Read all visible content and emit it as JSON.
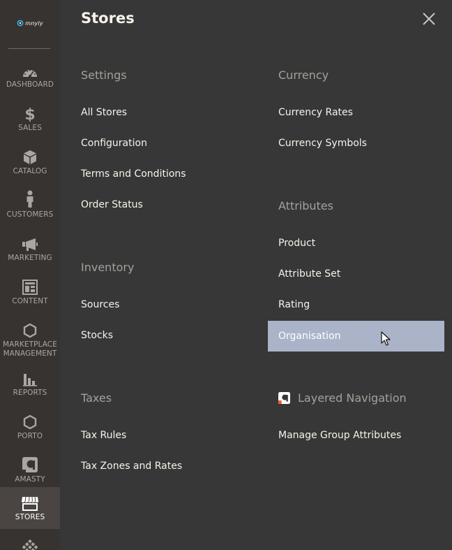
{
  "sidebar": {
    "logo_text": "mnyly",
    "items": [
      {
        "key": "dashboard",
        "label": "DASHBOARD",
        "icon": "dashboard-icon"
      },
      {
        "key": "sales",
        "label": "SALES",
        "icon": "dollar-icon"
      },
      {
        "key": "catalog",
        "label": "CATALOG",
        "icon": "box-icon"
      },
      {
        "key": "customers",
        "label": "CUSTOMERS",
        "icon": "person-icon"
      },
      {
        "key": "marketing",
        "label": "MARKETING",
        "icon": "megaphone-icon"
      },
      {
        "key": "content",
        "label": "CONTENT",
        "icon": "layout-icon"
      },
      {
        "key": "marketplace",
        "label": "MARKETPLACE\nMANAGEMENT",
        "label_line1": "MARKETPLACE",
        "label_line2": "MANAGEMENT",
        "icon": "hexagon-icon"
      },
      {
        "key": "reports",
        "label": "REPORTS",
        "icon": "bar-chart-icon"
      },
      {
        "key": "porto",
        "label": "PORTO",
        "icon": "hexagon-icon"
      },
      {
        "key": "amasty",
        "label": "AMASTY",
        "icon": "amasty-icon"
      },
      {
        "key": "stores",
        "label": "STORES",
        "icon": "storefront-icon",
        "active": true
      },
      {
        "key": "system",
        "label": "",
        "icon": "grid-diamond-icon"
      }
    ]
  },
  "panel": {
    "title": "Stores",
    "close_icon": "close-icon",
    "sections": {
      "settings": {
        "title": "Settings",
        "links": [
          "All Stores",
          "Configuration",
          "Terms and Conditions",
          "Order Status"
        ]
      },
      "inventory": {
        "title": "Inventory",
        "links": [
          "Sources",
          "Stocks"
        ]
      },
      "taxes": {
        "title": "Taxes",
        "links": [
          "Tax Rules",
          "Tax Zones and Rates"
        ]
      },
      "currency": {
        "title": "Currency",
        "links": [
          "Currency Rates",
          "Currency Symbols"
        ]
      },
      "attributes": {
        "title": "Attributes",
        "links": [
          "Product",
          "Attribute Set",
          "Rating",
          "Organisation"
        ],
        "hovered": "Organisation"
      },
      "layered_navigation": {
        "title": "Layered Navigation",
        "icon": "amasty-icon",
        "links": [
          "Manage Group Attributes"
        ]
      }
    }
  },
  "colors": {
    "sidebar_bg": "#373330",
    "sidebar_active_bg": "#4a4542",
    "panel_bg": "#373737",
    "section_title": "#a6a09a",
    "link_text": "#f7f3eb",
    "hover_bg": "#aab3c8",
    "amasty_accent": "#ea5b3a"
  }
}
